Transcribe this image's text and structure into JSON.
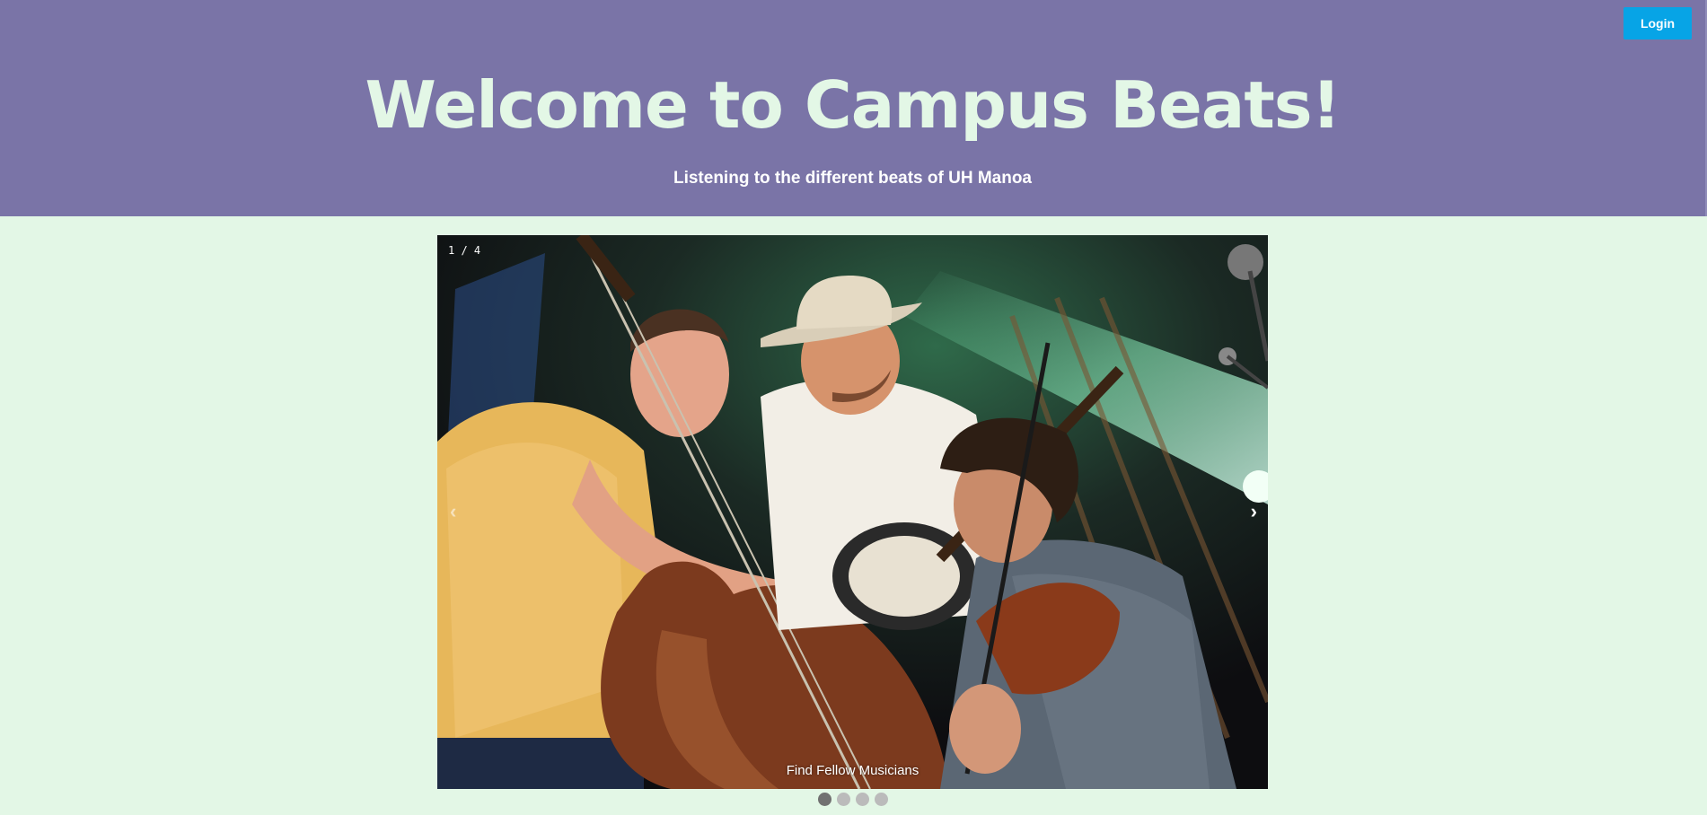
{
  "header": {
    "login_label": "Login",
    "title": "Welcome to Campus Beats!",
    "subtitle": "Listening to the different beats of UH Manoa"
  },
  "slideshow": {
    "counter": "1 / 4",
    "prev_icon": "‹",
    "next_icon": "›",
    "caption": "Find Fellow Musicians",
    "image_alt": "Musicians performing on stage with upright bass, banjo and fiddle",
    "current_slide": 1,
    "total_slides": 4
  },
  "colors": {
    "header_bg": "#7a74a7",
    "page_bg": "#e3f7e6",
    "login_button": "#07a4e6",
    "title_text": "#e3f7e6"
  }
}
